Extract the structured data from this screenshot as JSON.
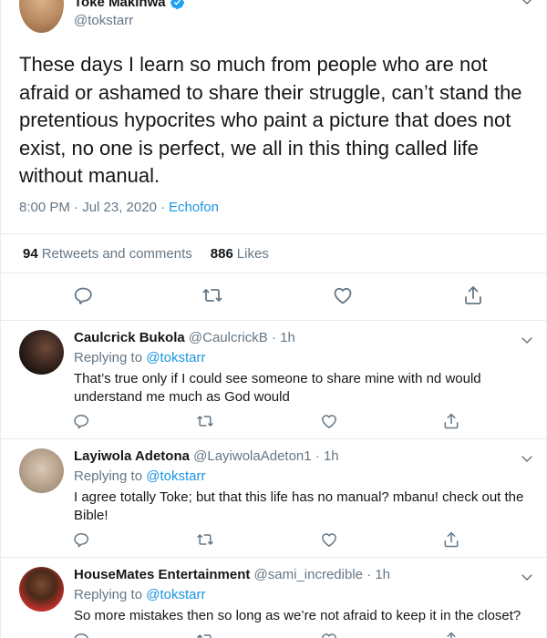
{
  "main_tweet": {
    "author_name": "Toke Makinwa",
    "author_handle": "@tokstarr",
    "text": "These days I learn so much from people who are not afraid or ashamed to share their struggle, can’t stand the pretentious hypocrites who paint a picture that does not exist, no one is perfect, we all in this thing called life without manual.",
    "timestamp": "8:00 PM · Jul 23, 2020",
    "separator": "·",
    "source": "Echofon",
    "retweets_count": "94",
    "retweets_label": "Retweets and comments",
    "likes_count": "886",
    "likes_label": "Likes"
  },
  "replies": [
    {
      "name": "Caulcrick Bukola",
      "handle": "@CaulcrickB · 1h",
      "replying_prefix": "Replying to",
      "replying_to": "@tokstarr",
      "text": "That’s true only if I could see someone to share mine with nd would understand me much as God would"
    },
    {
      "name": "Layiwola Adetona",
      "handle": "@LayiwolaAdeton1 · 1h",
      "replying_prefix": "Replying to",
      "replying_to": "@tokstarr",
      "text": "I agree totally Toke; but that this life has no manual? mbanu! check out the Bible!"
    },
    {
      "name": "HouseMates Entertainment",
      "handle": "@sami_incredible · 1h",
      "replying_prefix": "Replying to",
      "replying_to": "@tokstarr",
      "text": "So more mistakes then so long as we’re not afraid to keep it in the closet?"
    }
  ],
  "icons": {
    "reply": "reply-icon",
    "retweet": "retweet-icon",
    "like": "heart-icon",
    "share": "share-icon",
    "more": "chevron-down-icon",
    "verified": "verified-badge-icon"
  },
  "colors": {
    "accent": "#1b95e0",
    "secondary_text": "#657786",
    "primary_text": "#14171a",
    "divider": "#e6ecf0"
  }
}
